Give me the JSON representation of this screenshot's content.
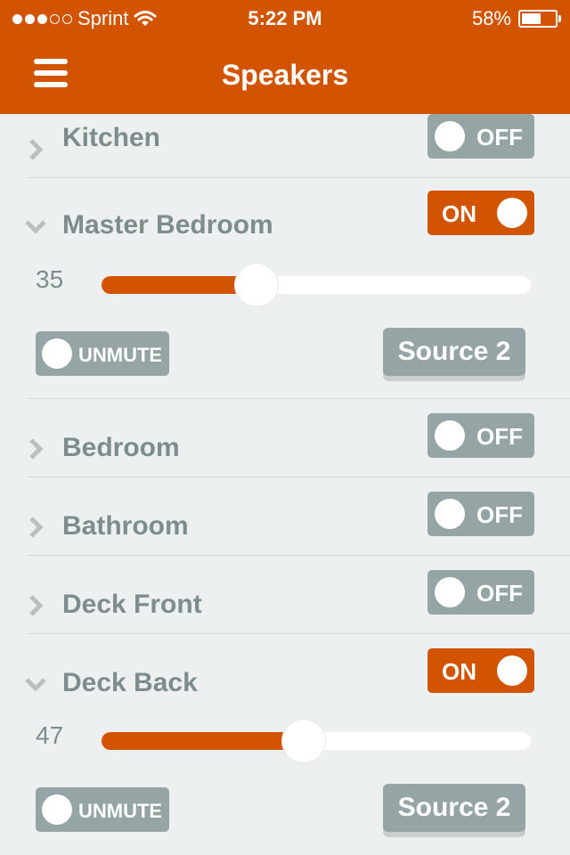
{
  "status_bar": {
    "carrier": "Sprint",
    "signal_bars_filled": 3,
    "signal_bars_total": 5,
    "time": "5:22 PM",
    "battery_percent": "58%",
    "battery_level": 0.58
  },
  "header": {
    "title": "Speakers"
  },
  "speakers": [
    {
      "name": "Kitchen",
      "state": "OFF",
      "expanded": false
    },
    {
      "name": "Master Bedroom",
      "state": "ON",
      "expanded": true,
      "volume": 35,
      "slider_fraction": 0.36,
      "mute_label": "UNMUTE",
      "source_label": "Source 2"
    },
    {
      "name": "Bedroom",
      "state": "OFF",
      "expanded": false
    },
    {
      "name": "Bathroom",
      "state": "OFF",
      "expanded": false
    },
    {
      "name": "Deck Front",
      "state": "OFF",
      "expanded": false
    },
    {
      "name": "Deck Back",
      "state": "ON",
      "expanded": true,
      "volume": 47,
      "slider_fraction": 0.47,
      "mute_label": "UNMUTE",
      "source_label": "Source 2"
    }
  ],
  "colors": {
    "accent": "#d35400",
    "off": "#95a5a6",
    "text": "#7f8c8d",
    "background": "#edf0f0"
  },
  "icons": {
    "menu": "hamburger-menu-icon",
    "collapsed": "chevron-right-icon",
    "expanded": "chevron-down-icon",
    "wifi": "wifi-icon",
    "battery": "battery-icon"
  }
}
